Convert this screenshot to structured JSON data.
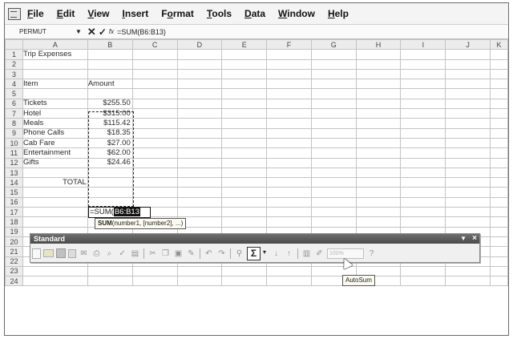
{
  "menu": [
    "File",
    "Edit",
    "View",
    "Insert",
    "Format",
    "Tools",
    "Data",
    "Window",
    "Help"
  ],
  "menu_underline": [
    "F",
    "E",
    "V",
    "I",
    "o",
    "T",
    "D",
    "W",
    "H"
  ],
  "formula_bar": {
    "name_box": "PERMUT",
    "cancel": "✕",
    "enter": "✓",
    "fx": "fx",
    "formula": "=SUM(B6:B13)"
  },
  "columns": [
    "A",
    "B",
    "C",
    "D",
    "E",
    "F",
    "G",
    "H",
    "I",
    "J",
    "K"
  ],
  "rows": [
    {
      "n": "1",
      "a": "Trip Expenses",
      "b": ""
    },
    {
      "n": "2",
      "a": "",
      "b": ""
    },
    {
      "n": "3",
      "a": "",
      "b": ""
    },
    {
      "n": "4",
      "a": "Item",
      "b": "Amount"
    },
    {
      "n": "5",
      "a": "",
      "b": ""
    },
    {
      "n": "6",
      "a": "Tickets",
      "b": "$255.50"
    },
    {
      "n": "7",
      "a": "Hotel",
      "b": "$315.00"
    },
    {
      "n": "8",
      "a": "Meals",
      "b": "$115.42"
    },
    {
      "n": "9",
      "a": "Phone Calls",
      "b": "$18.35"
    },
    {
      "n": "10",
      "a": "Cab Fare",
      "b": "$27.00"
    },
    {
      "n": "11",
      "a": "Entertainment",
      "b": "$62.00"
    },
    {
      "n": "12",
      "a": "Gifts",
      "b": "$24.46"
    },
    {
      "n": "13",
      "a": "",
      "b": ""
    },
    {
      "n": "14",
      "a": "TOTAL",
      "b": ""
    },
    {
      "n": "15",
      "a": "",
      "b": ""
    },
    {
      "n": "16",
      "a": "",
      "b": ""
    },
    {
      "n": "17",
      "a": "",
      "b": ""
    },
    {
      "n": "18",
      "a": "",
      "b": ""
    },
    {
      "n": "19",
      "a": "",
      "b": ""
    },
    {
      "n": "20",
      "a": "",
      "b": ""
    },
    {
      "n": "21",
      "a": "",
      "b": ""
    },
    {
      "n": "22",
      "a": "",
      "b": ""
    },
    {
      "n": "23",
      "a": "",
      "b": ""
    },
    {
      "n": "24",
      "a": "",
      "b": ""
    }
  ],
  "edit_cell": {
    "prefix": "=SUM(",
    "range": "B6:B13"
  },
  "function_tip": {
    "name": "SUM",
    "args": "(number1, [number2], ...)"
  },
  "toolbar": {
    "title": "Standard",
    "menu_arrow": "▼",
    "close": "×",
    "autosum_symbol": "Σ",
    "autosum_dropdown": "▾",
    "zoom": "100%"
  },
  "autosum_tooltip": "AutoSum"
}
